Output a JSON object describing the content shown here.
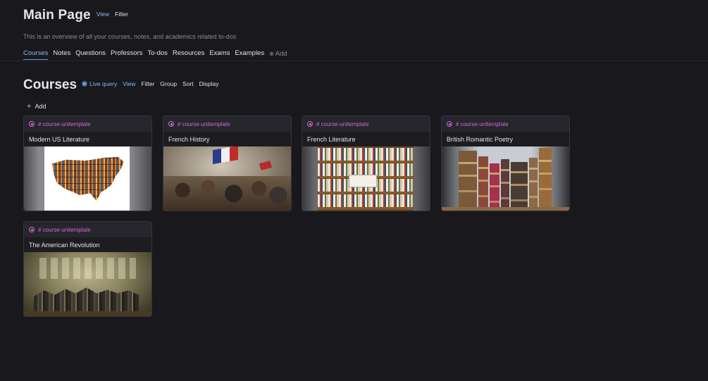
{
  "header": {
    "title": "Main Page",
    "view_label": "View",
    "filter_label": "Filter",
    "subtitle": "This is an overview of all your courses, notes, and academics related to-dos"
  },
  "tabs": [
    {
      "label": "Courses",
      "active": true
    },
    {
      "label": "Notes"
    },
    {
      "label": "Questions"
    },
    {
      "label": "Professors"
    },
    {
      "label": "To-dos"
    },
    {
      "label": "Resources"
    },
    {
      "label": "Exams"
    },
    {
      "label": "Examples"
    }
  ],
  "tab_add_label": "Add",
  "section": {
    "title": "Courses",
    "live_query_label": "Live query",
    "view_label": "View",
    "filter_label": "Filter",
    "group_label": "Group",
    "sort_label": "Sort",
    "display_label": "Display",
    "add_label": "Add"
  },
  "cards": [
    {
      "tag": "# course-unitemplate",
      "name": "Modern US Literature",
      "image": "us-map-of-books"
    },
    {
      "tag": "# course-unitemplate",
      "name": "French History",
      "image": "liberty-leading-painting"
    },
    {
      "tag": "# course-unitemplate",
      "name": "French Literature",
      "image": "bookshop-shelves"
    },
    {
      "tag": "# course-unitemplate",
      "name": "British Romantic Poetry",
      "image": "antique-books"
    },
    {
      "tag": "# course-unitemplate",
      "name": "The American Revolution",
      "image": "declaration-painting"
    }
  ],
  "colors": {
    "background": "#18181d",
    "accent": "#8fb6f0",
    "tag": "#d268d8"
  }
}
